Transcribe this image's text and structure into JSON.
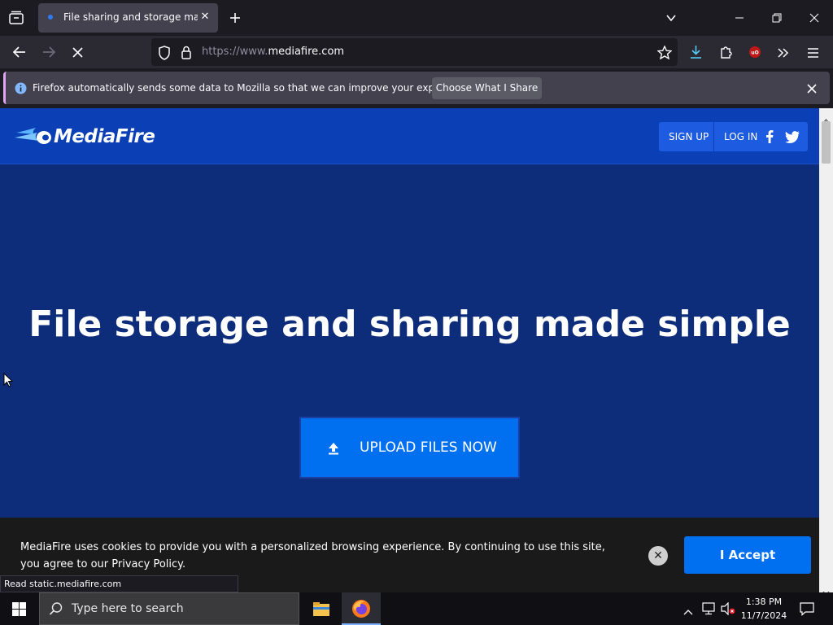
{
  "browser": {
    "tab_title": "File sharing and storage made s",
    "url_prefix": "https://www.",
    "url_domain": "mediafire.com",
    "notification_text": "Firefox automatically sends some data to Mozilla so that we can improve your experience.",
    "notification_button": "Choose What I Share",
    "status_text": "Read static.mediafire.com"
  },
  "site": {
    "logo_text": "MediaFire",
    "nav": {
      "signup": "SIGN UP",
      "login": "LOG IN"
    },
    "hero_title": "File storage and sharing made simple",
    "upload_label": "UPLOAD FILES NOW"
  },
  "cookie_banner": {
    "text": "MediaFire uses cookies to provide you with a personalized browsing experience. By continuing to use this site, you agree to our Privacy Policy.",
    "accept_label": "I Accept"
  },
  "taskbar": {
    "search_placeholder": "Type here to search",
    "time": "1:38 PM",
    "date": "11/7/2024"
  },
  "colors": {
    "page_bg": "#0d2d7a",
    "header_bg": "#0a3fb5",
    "accent": "#0070f0"
  }
}
